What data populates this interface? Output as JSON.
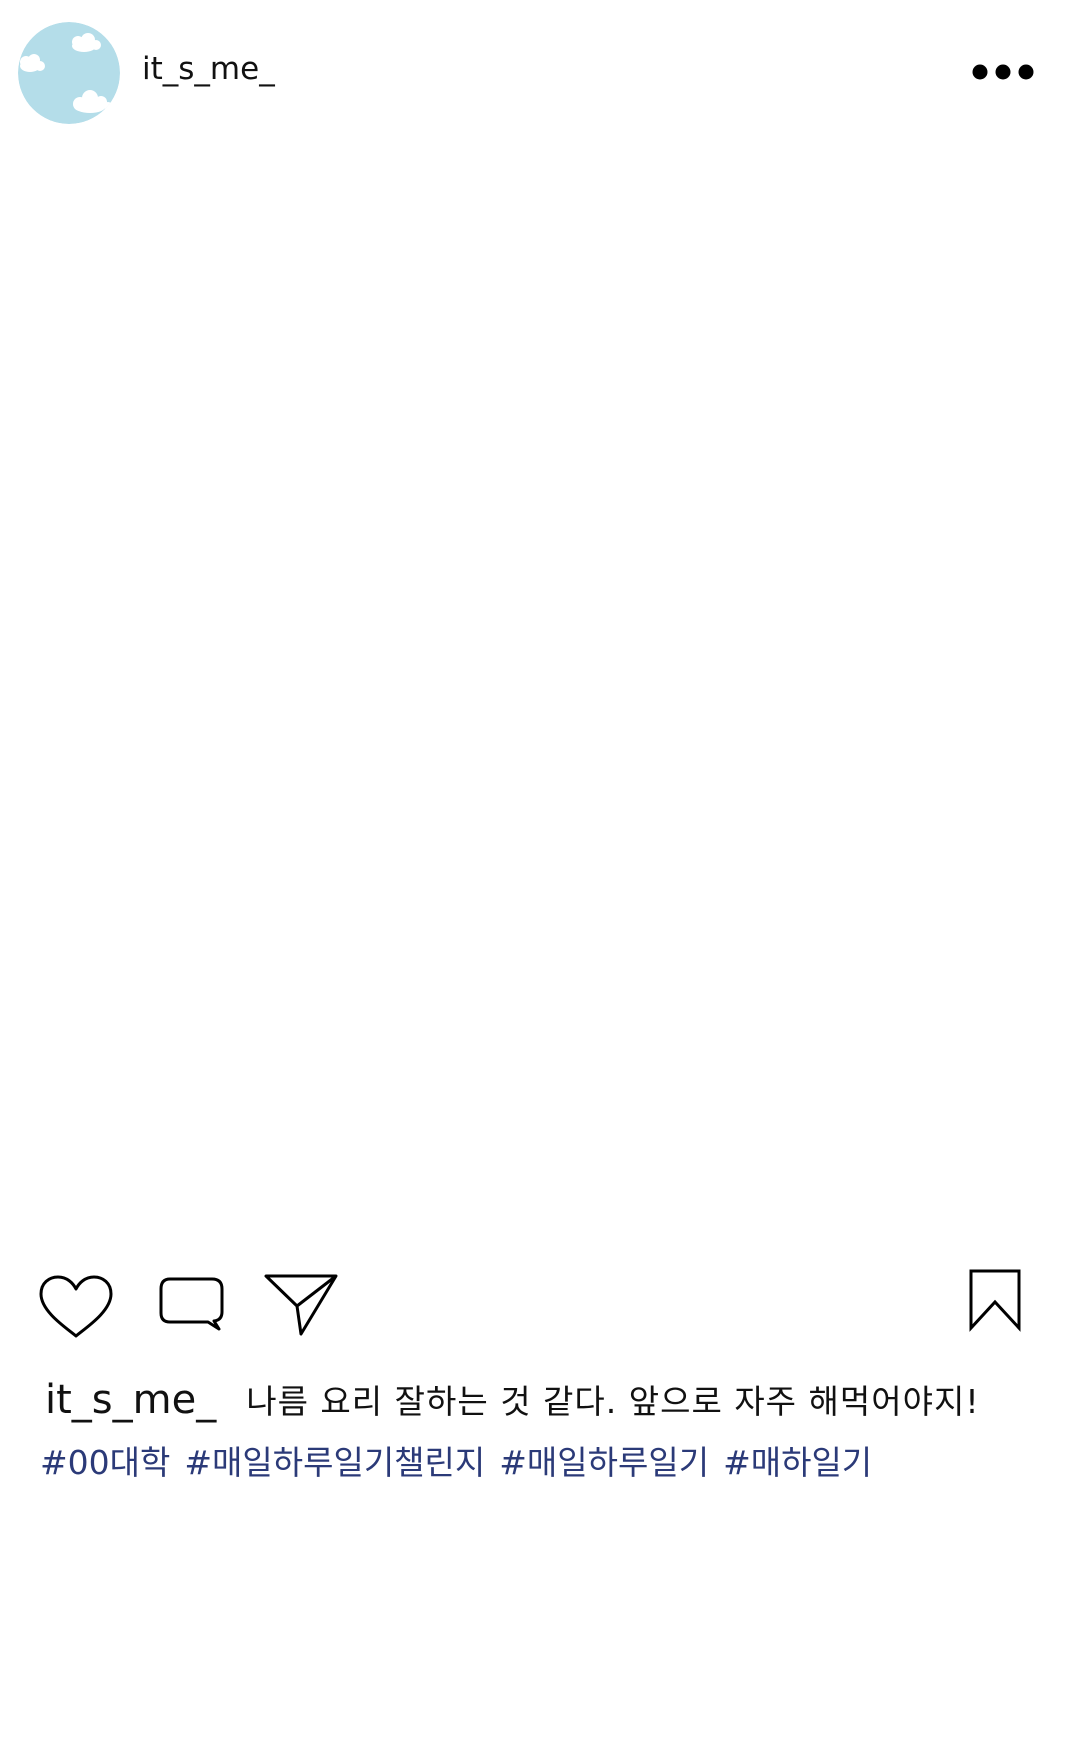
{
  "post": {
    "username": "it_s_me_",
    "caption": "나름 요리 잘하는 것 같다. 앞으로 자주 해먹어야지!",
    "hashtags": [
      "#00대학",
      "#매일하루일기챌린지",
      "#매일하루일기",
      "#매하일기"
    ]
  },
  "header": {
    "more_icon": "more-horizontal-icon"
  },
  "actions": {
    "like_icon": "heart-icon",
    "comment_icon": "comment-bubble-icon",
    "share_icon": "send-icon",
    "save_icon": "bookmark-icon"
  },
  "colors": {
    "background": "#ffffff",
    "text": "#111111",
    "hashtag": "#2b3a78",
    "avatar_sky": "#b4dde9",
    "avatar_cloud": "#ffffff"
  }
}
